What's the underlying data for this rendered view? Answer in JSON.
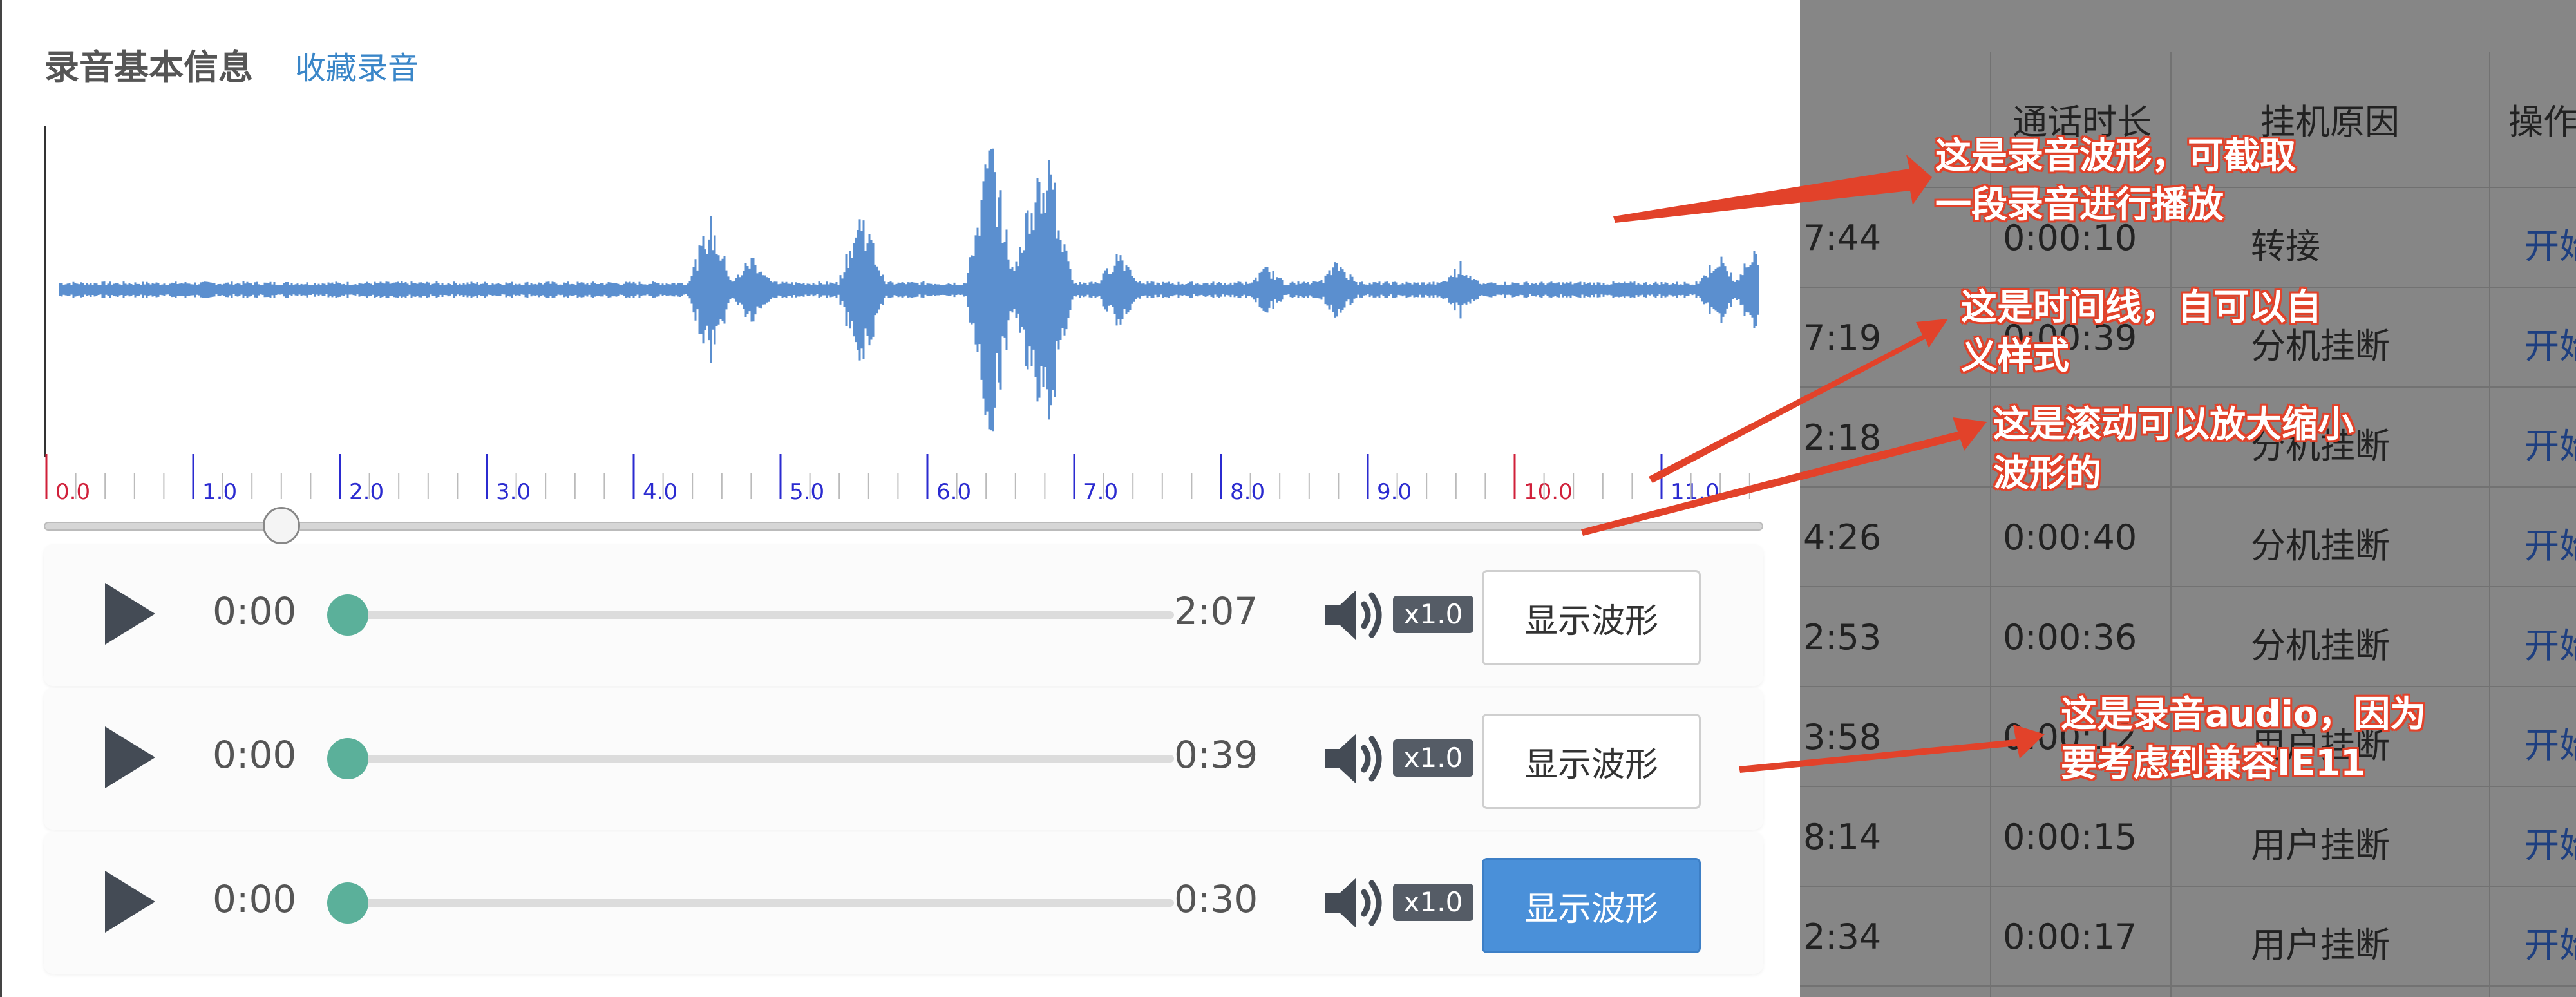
{
  "dialog": {
    "title": "录音基本信息",
    "favorite_link": "收藏录音"
  },
  "waveform": {
    "ticks": [
      "0.0",
      "1.0",
      "2.0",
      "3.0",
      "4.0",
      "5.0",
      "6.0",
      "7.0",
      "8.0",
      "9.0",
      "10.0",
      "11.0"
    ],
    "wave_color": "#5b8fcf",
    "tick_color": "#2b2bd0",
    "tick_highlight_color": "#d0203a"
  },
  "players": [
    {
      "current": "0:00",
      "duration": "2:07",
      "speed": "x1.0",
      "button": "显示波形",
      "active": false
    },
    {
      "current": "0:00",
      "duration": "0:39",
      "speed": "x1.0",
      "button": "显示波形",
      "active": false
    },
    {
      "current": "0:00",
      "duration": "0:30",
      "speed": "x1.0",
      "button": "显示波形",
      "active": true
    }
  ],
  "background_table": {
    "headers": [
      "通话时长",
      "挂机原因",
      "操作"
    ],
    "rows": [
      {
        "time": "7:44",
        "duration": "0:00:10",
        "reason": "转接",
        "op": "开始"
      },
      {
        "time": "7:19",
        "duration": "0:00:39",
        "reason": "分机挂断",
        "op": "开始"
      },
      {
        "time": "2:18",
        "duration": "",
        "reason": "分机挂断",
        "op": "开始"
      },
      {
        "time": "4:26",
        "duration": "0:00:40",
        "reason": "分机挂断",
        "op": "开始"
      },
      {
        "time": "2:53",
        "duration": "0:00:36",
        "reason": "分机挂断",
        "op": "开始"
      },
      {
        "time": "3:58",
        "duration": "0:00:12",
        "reason": "用户挂断",
        "op": "开始"
      },
      {
        "time": "8:14",
        "duration": "0:00:15",
        "reason": "用户挂断",
        "op": "开始"
      },
      {
        "time": "2:34",
        "duration": "0:00:17",
        "reason": "用户挂断",
        "op": "开始"
      }
    ]
  },
  "annotations": {
    "waveform_note_l1": "这是录音波形，可截取",
    "waveform_note_l2": "一段录音进行播放",
    "timeline_note_l1": "这是时间线，自可以自",
    "timeline_note_l2": "义样式",
    "zoom_note_l1": "这是滚动可以放大缩小",
    "zoom_note_l2": "波形的",
    "audio_note_l1": "这是录音audio，因为",
    "audio_note_l2": "要考虑到兼容IE11",
    "color": "#e2422a"
  },
  "colors": {
    "link": "#3a86c8",
    "progress_thumb": "#5bb09a",
    "primary_button": "#4a90d9"
  }
}
